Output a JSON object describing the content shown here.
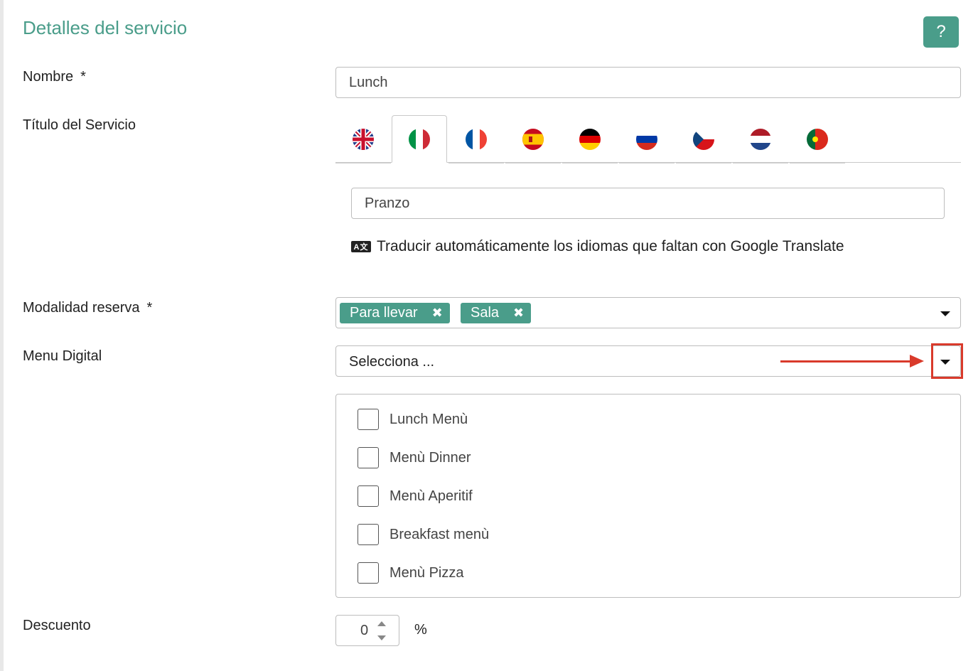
{
  "page_title": "Detalles del servicio",
  "help_label": "?",
  "fields": {
    "nombre": {
      "label": "Nombre",
      "required_mark": "*",
      "value": "Lunch"
    },
    "titulo": {
      "label": "Título del Servicio",
      "languages": [
        "english-flag-icon",
        "italian-flag-icon",
        "french-flag-icon",
        "spanish-flag-icon",
        "german-flag-icon",
        "russian-flag-icon",
        "czech-flag-icon",
        "dutch-flag-icon",
        "portuguese-flag-icon"
      ],
      "active_language": "italian",
      "value": "Pranzo",
      "translate_icon": "translate-icon",
      "translate_text": "Traducir automáticamente los idiomas que faltan con Google Translate"
    },
    "modalidad": {
      "label": "Modalidad reserva",
      "required_mark": "*",
      "tags": [
        "Para llevar",
        "Sala"
      ],
      "tag_remove": "✖"
    },
    "menu_digital": {
      "label": "Menu Digital",
      "placeholder": "Selecciona ...",
      "options": [
        "Lunch Menù",
        "Menù Dinner",
        "Menù Aperitif",
        "Breakfast menù",
        "Menù Pizza"
      ]
    },
    "descuento": {
      "label": "Descuento",
      "value": "0",
      "unit": "%"
    }
  },
  "colors": {
    "accent": "#4a9d8a",
    "annotation": "#d93a2b",
    "border": "#bdbdbd"
  }
}
